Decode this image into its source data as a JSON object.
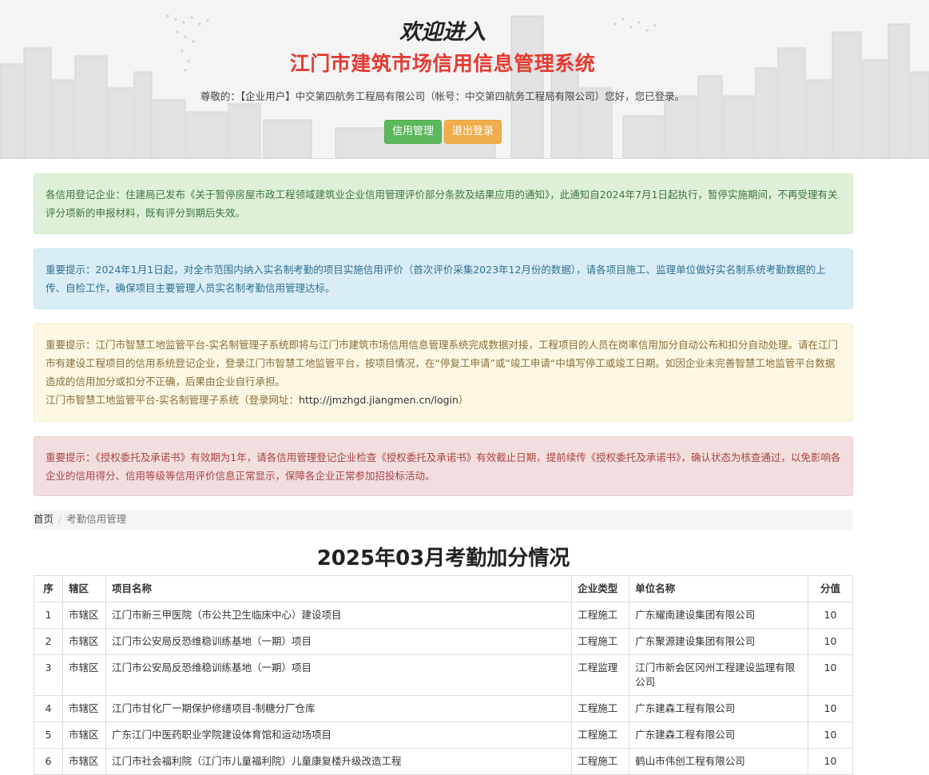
{
  "header": {
    "welcome": "欢迎进入",
    "system_title": "江门市建筑市场信用信息管理系统",
    "greeting": "尊敬的：【企业用户】中交第四航务工程局有限公司（帐号：中交第四航务工程局有限公司）您好，您已登录。",
    "buttons": {
      "credit": "信用管理",
      "logout": "退出登录"
    }
  },
  "alerts": [
    {
      "type": "success",
      "text": "各信用登记企业：住建局已发布《关于暂停房屋市政工程领域建筑业企业信用管理评价部分条款及结果应用的通知》，此通知自2024年7月1日起执行，暂停实施期间，不再受理有关评分项新的申报材料，既有评分到期后失效。"
    },
    {
      "type": "info",
      "text": "重要提示：2024年1月1日起，对全市范围内纳入实名制考勤的项目实施信用评价（首次评价采集2023年12月份的数据），请各项目施工、监理单位做好实名制系统考勤数据的上传、自检工作，确保项目主要管理人员实名制考勤信用管理达标。"
    },
    {
      "type": "warning",
      "text": "重要提示：江门市智慧工地监管平台-实名制管理子系统即将与江门市建筑市场信用信息管理系统完成数据对接，工程项目的人员在岗率信用加分自动公布和扣分自动处理。请在江门市有建设工程项目的信用系统登记企业，登录江门市智慧工地监管平台，按项目情况，在“停复工申请”或“竣工申请“中填写停工或竣工日期。如因企业未完善智慧工地监管平台数据造成的信用加分或扣分不正确，后果由企业自行承担。",
      "line2_prefix": "江门市智慧工地监管平台-实名制管理子系统（登录网址：",
      "line2_url": "http://jmzhgd.jiangmen.cn/login",
      "line2_suffix": "）"
    },
    {
      "type": "danger",
      "text": "重要提示：《授权委托及承诺书》有效期为1年，请各信用管理登记企业检查《授权委托及承诺书》有效截止日期，提前续传《授权委托及承诺书》，确认状态为核查通过，以免影响各企业的信用得分、信用等级等信用评价信息正常显示，保障各企业正常参加招投标活动。"
    }
  ],
  "breadcrumb": {
    "home": "首页",
    "separator": "/",
    "current": "考勤信用管理"
  },
  "page_heading": "2025年03月考勤加分情况",
  "table": {
    "headers": [
      "序",
      "辖区",
      "项目名称",
      "企业类型",
      "单位名称",
      "分值"
    ],
    "rows": [
      [
        "1",
        "市辖区",
        "江门市新三甲医院（市公共卫生临床中心）建设项目",
        "工程施工",
        "广东耀南建设集团有限公司",
        "10"
      ],
      [
        "2",
        "市辖区",
        "江门市公安局反恐维稳训练基地（一期）项目",
        "工程施工",
        "广东聚源建设集团有限公司",
        "10"
      ],
      [
        "3",
        "市辖区",
        "江门市公安局反恐维稳训练基地（一期）项目",
        "工程监理",
        "江门市新会区冈州工程建设监理有限公司",
        "10"
      ],
      [
        "4",
        "市辖区",
        "江门市甘化厂一期保护修缮项目-制糖分厂仓库",
        "工程施工",
        "广东建森工程有限公司",
        "10"
      ],
      [
        "5",
        "市辖区",
        "广东江门中医药职业学院建设体育馆和运动场项目",
        "工程施工",
        "广东建森工程有限公司",
        "10"
      ],
      [
        "6",
        "市辖区",
        "江门市社会福利院（江门市儿童福利院）儿童康复楼升级改造工程",
        "工程施工",
        "鹤山市伟创工程有限公司",
        "10"
      ]
    ]
  }
}
